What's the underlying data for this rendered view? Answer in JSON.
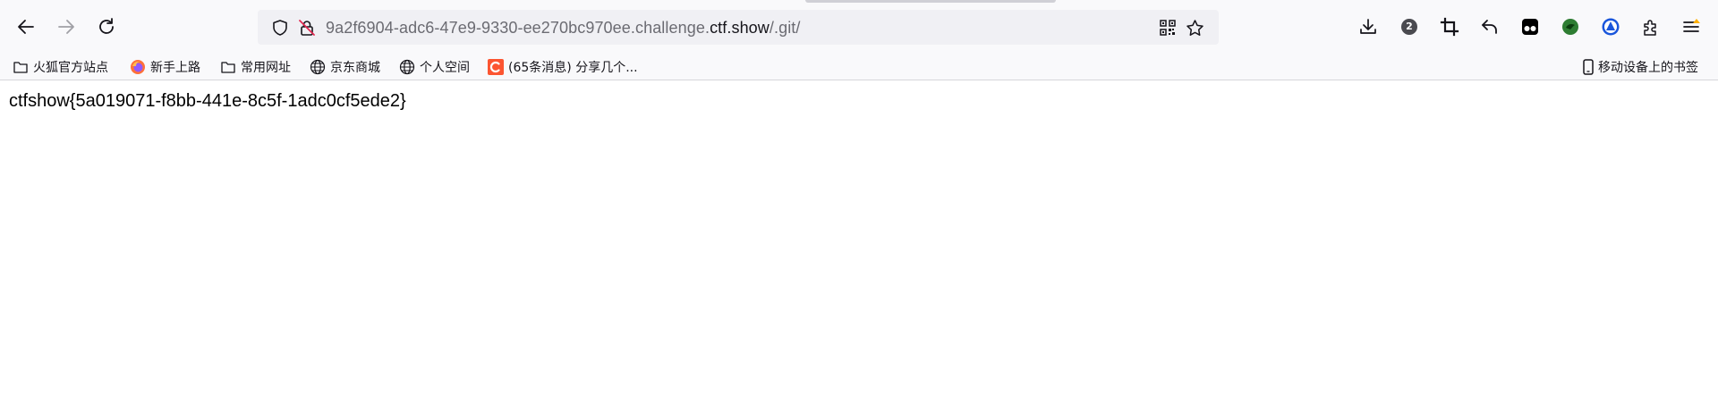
{
  "browser": {
    "url_host_prefix": "9a2f6904-adc6-47e9-9330-ee270bc970ee.challenge.",
    "url_domain": "ctf.show",
    "url_path": "/.git/",
    "extension_badge": "2"
  },
  "bookmarks": {
    "items": [
      {
        "label": "火狐官方站点",
        "icon": "folder-icon"
      },
      {
        "label": "新手上路",
        "icon": "firefox-icon"
      },
      {
        "label": "常用网址",
        "icon": "folder-icon"
      },
      {
        "label": "京东商城",
        "icon": "globe-icon"
      },
      {
        "label": "个人空间",
        "icon": "globe-icon"
      },
      {
        "label": "(65条消息) 分享几个...",
        "icon": "csdn-icon"
      }
    ],
    "mobile_label": "移动设备上的书签"
  },
  "page": {
    "flag_text": "ctfshow{5a019071-f8bb-441e-8c5f-1adc0cf5ede2}"
  },
  "colors": {
    "toolbar_bg": "#f9f9fb",
    "urlbar_bg": "#f0f0f4",
    "csdn_red": "#fc5531"
  }
}
